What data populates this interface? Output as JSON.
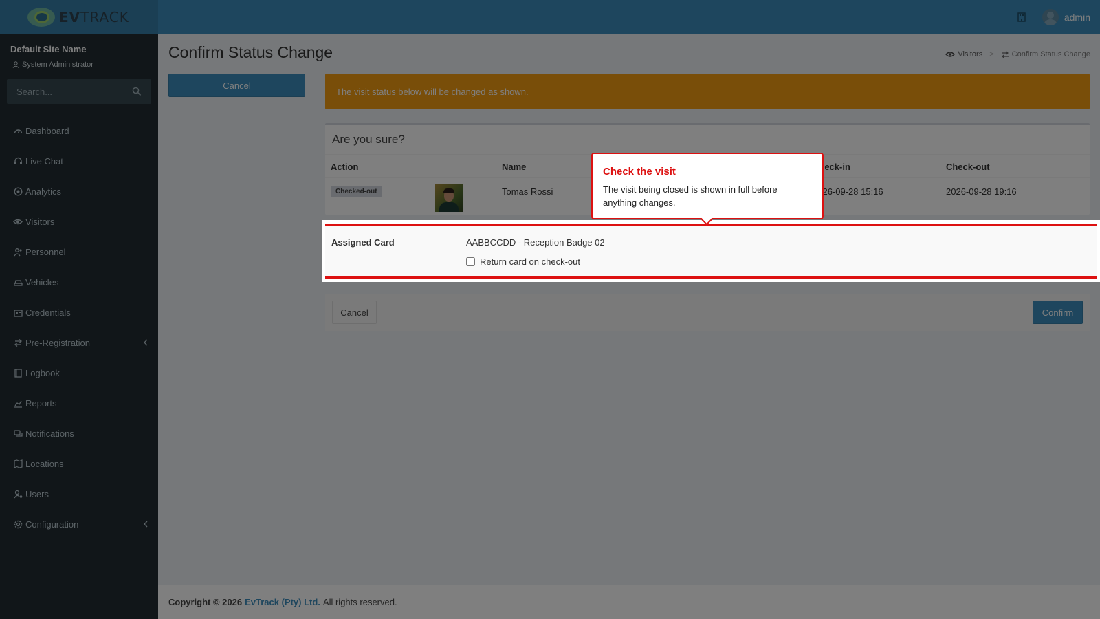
{
  "brand": {
    "name_bold": "EV",
    "name_rest": "TRACK"
  },
  "topbar": {
    "username": "admin"
  },
  "sidebar": {
    "site_name": "Default Site Name",
    "role": "System Administrator",
    "search_placeholder": "Search...",
    "items": [
      {
        "label": "Dashboard",
        "icon": "dashboard-icon"
      },
      {
        "label": "Live Chat",
        "icon": "headset-icon"
      },
      {
        "label": "Analytics",
        "icon": "target-icon"
      },
      {
        "label": "Visitors",
        "icon": "eye-icon"
      },
      {
        "label": "Personnel",
        "icon": "users-icon"
      },
      {
        "label": "Vehicles",
        "icon": "car-icon"
      },
      {
        "label": "Credentials",
        "icon": "id-card-icon"
      },
      {
        "label": "Pre-Registration",
        "icon": "exchange-icon",
        "expandable": true
      },
      {
        "label": "Logbook",
        "icon": "book-icon"
      },
      {
        "label": "Reports",
        "icon": "chart-icon"
      },
      {
        "label": "Notifications",
        "icon": "comments-icon"
      },
      {
        "label": "Locations",
        "icon": "map-icon"
      },
      {
        "label": "Users",
        "icon": "user-cog-icon"
      },
      {
        "label": "Configuration",
        "icon": "gear-icon",
        "expandable": true
      }
    ]
  },
  "page": {
    "title": "Confirm Status Change",
    "breadcrumb": [
      "Visitors",
      "Confirm Status Change"
    ],
    "cancel_label": "Cancel"
  },
  "alert": {
    "text": "The visit status below will be changed as shown."
  },
  "confirm_box": {
    "title": "Are you sure?",
    "columns": [
      "Action",
      "Name",
      "Check-in",
      "Check-out"
    ],
    "row": {
      "action": "Checked-out",
      "name": "Tomas Rossi",
      "check_in": "2026-09-28 15:16",
      "check_out": "2026-09-28 19:16"
    }
  },
  "assigned_card": {
    "label": "Assigned Card",
    "value": "AABBCCDD - Reception Badge 02",
    "return_label": "Return card on check-out",
    "return_checked": false
  },
  "actions": {
    "cancel": "Cancel",
    "confirm": "Confirm"
  },
  "tooltip": {
    "title": "Check the visit",
    "body": "The visit being closed is shown in full before anything changes."
  },
  "footer": {
    "copyright": "Copyright © 2026",
    "company": "EvTrack (Pty) Ltd.",
    "rights": "All rights reserved."
  },
  "colors": {
    "primary": "#3c8dbc",
    "warning": "#f39c12",
    "highlight": "#dd1111",
    "sidebar": "#222d32"
  }
}
